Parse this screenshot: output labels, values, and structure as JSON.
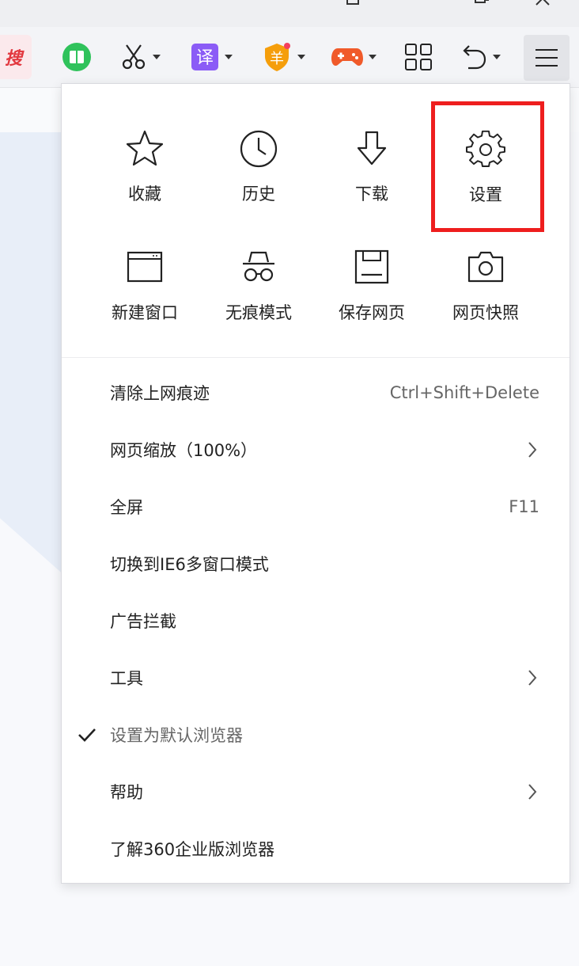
{
  "toolbar": {
    "search_chip_label": "搜",
    "icons": [
      "book-icon",
      "scissors-icon",
      "translate-icon",
      "shield-icon",
      "gamepad-icon",
      "apps-grid-icon",
      "undo-icon",
      "menu-icon"
    ],
    "translate_glyph": "译",
    "shield_glyph": "羊"
  },
  "menu": {
    "grid": [
      {
        "label": "收藏",
        "icon": "star-icon"
      },
      {
        "label": "历史",
        "icon": "clock-icon"
      },
      {
        "label": "下载",
        "icon": "download-icon"
      },
      {
        "label": "设置",
        "icon": "gear-icon"
      },
      {
        "label": "新建窗口",
        "icon": "window-icon"
      },
      {
        "label": "无痕模式",
        "icon": "incognito-icon"
      },
      {
        "label": "保存网页",
        "icon": "save-icon"
      },
      {
        "label": "网页快照",
        "icon": "camera-icon"
      }
    ],
    "items": [
      {
        "label": "清除上网痕迹",
        "shortcut": "Ctrl+Shift+Delete"
      },
      {
        "label": "网页缩放（100%）",
        "submenu": true
      },
      {
        "label": "全屏",
        "shortcut": "F11"
      },
      {
        "label": "切换到IE6多窗口模式"
      },
      {
        "label": "广告拦截"
      },
      {
        "label": "工具",
        "submenu": true
      },
      {
        "label": "设置为默认浏览器",
        "checked": true
      },
      {
        "label": "帮助",
        "submenu": true
      },
      {
        "label": "了解360企业版浏览器"
      }
    ]
  },
  "colors": {
    "highlight": "#ee1e1e",
    "accent_green": "#2fc25b",
    "accent_purple": "#8b5cf6",
    "accent_orange": "#f59e0b",
    "accent_red": "#f05a2a"
  }
}
